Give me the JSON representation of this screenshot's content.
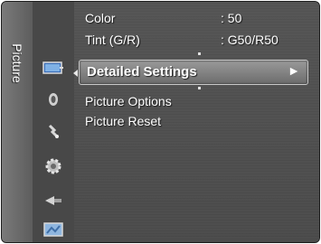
{
  "sidebar": {
    "title": "Picture"
  },
  "icons": [
    "picture-icon",
    "sound-icon",
    "channel-icon",
    "setup-icon",
    "input-icon",
    "application-icon"
  ],
  "menu": {
    "color": {
      "label": "Color",
      "value": ": 50"
    },
    "tint": {
      "label": "Tint (G/R)",
      "value": ": G50/R50"
    },
    "detailed_settings": {
      "label": "Detailed Settings",
      "arrow": "►"
    },
    "picture_options": {
      "label": "Picture Options"
    },
    "picture_reset": {
      "label": "Picture Reset"
    }
  }
}
